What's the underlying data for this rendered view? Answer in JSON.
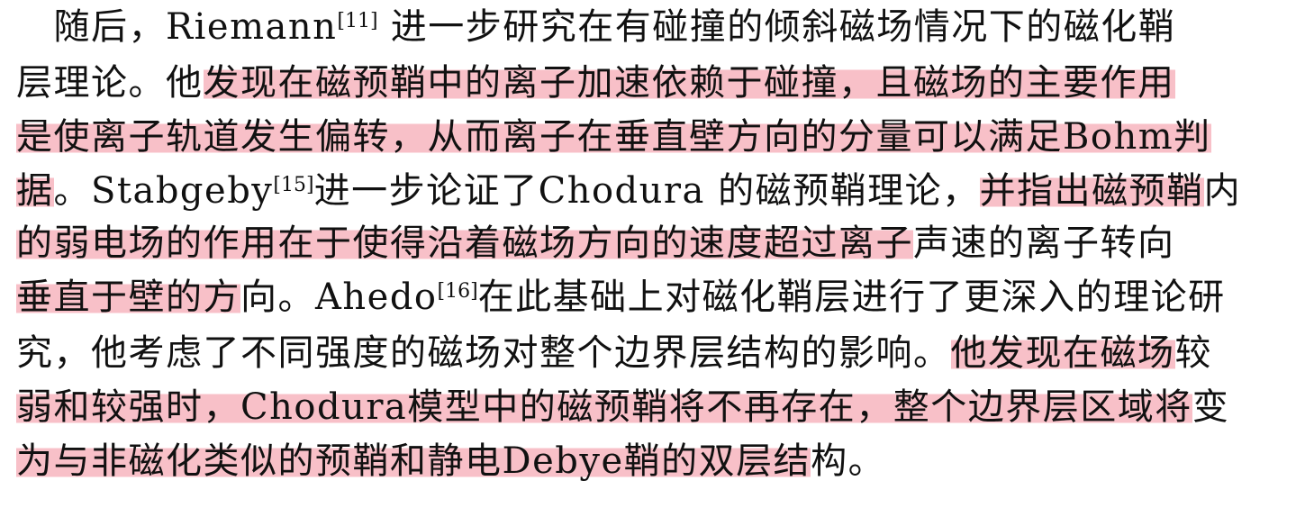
{
  "paragraph": {
    "lines": [
      [
        {
          "t": "　随后，Riemann"
        },
        {
          "sup": "[11]"
        },
        {
          "t": " 进一步研究在有碰撞的倾斜磁场情况下的磁化鞘"
        }
      ],
      [
        {
          "t": "层理论。他"
        },
        {
          "t": "发现在磁预鞘中的离子加速依赖于碰撞，且磁场的主要作用",
          "hl": true
        }
      ],
      [
        {
          "t": "是使离子轨道发生偏转，从而离子在垂直壁方向的分量可以满足Bohm判",
          "hl": true
        }
      ],
      [
        {
          "t": "据",
          "hl": true
        },
        {
          "t": "。Stabgeby"
        },
        {
          "sup": "[15]"
        },
        {
          "t": "进一步论证了Chodura 的磁预鞘理论，"
        },
        {
          "t": "并指出磁预鞘",
          "hl": true
        },
        {
          "t": "内"
        }
      ],
      [
        {
          "t": "的弱电场的作用在于使得沿着磁场方向的速度超过离子",
          "hl": true
        },
        {
          "t": "声速的离子转向"
        }
      ],
      [
        {
          "t": "垂直于壁的方",
          "hl": true
        },
        {
          "t": "向。Ahedo"
        },
        {
          "sup": "[16]"
        },
        {
          "t": "在此基础上对磁化鞘层进行了更深入的理论研"
        }
      ],
      [
        {
          "t": "究，他考虑了不同强度的磁场对整个边界层结构的影响。"
        },
        {
          "t": "他发现在磁场",
          "hl": true
        },
        {
          "t": "较"
        }
      ],
      [
        {
          "t": "弱和较强时，Chodura模型中的磁预鞘将不再存在，整个边界层区域将",
          "hl": true
        },
        {
          "t": "变"
        }
      ],
      [
        {
          "t": "为与非磁化类似的预鞘和静电Debye鞘的双层结",
          "hl": true
        },
        {
          "t": "构。"
        }
      ]
    ]
  },
  "colors": {
    "highlight": "#f8c0c8",
    "text": "#111111",
    "background": "#ffffff"
  }
}
